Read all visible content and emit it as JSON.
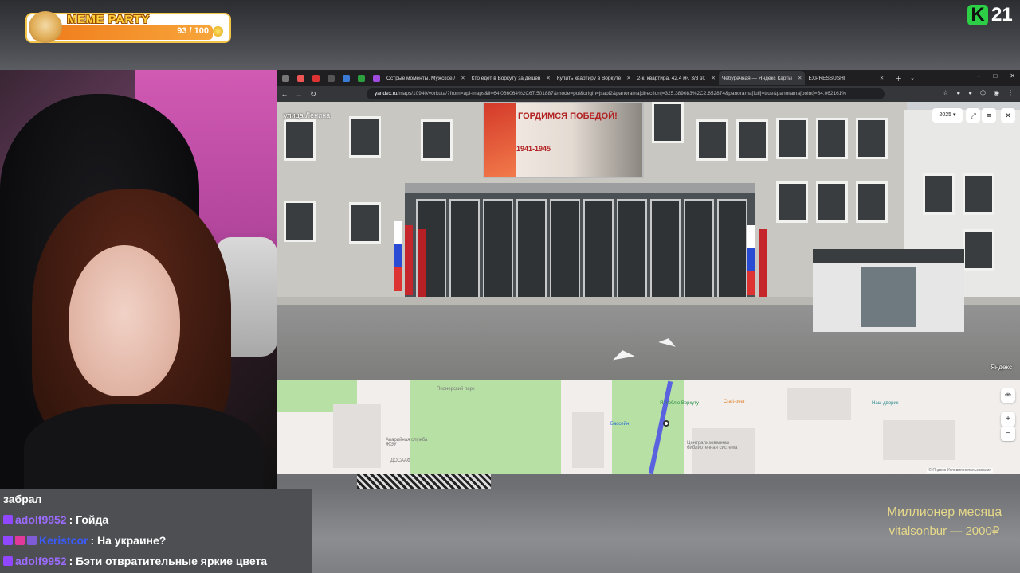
{
  "meme_widget": {
    "title": "MEME PARTY",
    "progress_text": "93 / 100",
    "progress": 0.93
  },
  "logo": {
    "k": "K",
    "num": "21"
  },
  "browser": {
    "tabs": [
      {
        "label": "Острые моменты. Мужское /",
        "active": false
      },
      {
        "label": "Кто едет в Воркуту за дешев",
        "active": false
      },
      {
        "label": "Купить квартиру в Воркуте",
        "active": false
      },
      {
        "label": "2-к. квартира, 42,4 м², 3/3 эт.",
        "active": false
      },
      {
        "label": "Чебуречная — Яндекс Карты",
        "active": true
      },
      {
        "label": "EXPRESSUSHI",
        "active": false
      }
    ],
    "url_host": "yandex.ru",
    "url_rest": "/maps/10940/vorkuta/?from=api-maps&ll=64.066064%2C67.501887&mode=poi&origin=jsapi2&panorama[direction]=325.389083%2C2.852874&panorama[full]=true&panorama[point]=64.062161%"
  },
  "panorama": {
    "street": "улица Ленина",
    "year": "2025",
    "banner_title": "ГОРДИМСЯ ПОБЕДОЙ!",
    "banner_years": "1941-1945",
    "brand": "Яндекс"
  },
  "map": {
    "labels": [
      {
        "text": "Пионерский парк"
      },
      {
        "text": "Я люблю Воркуту"
      },
      {
        "text": "Craft-bear"
      },
      {
        "text": "Бассейн"
      },
      {
        "text": "Наш дворик"
      },
      {
        "text": "Централизованная библиотечная система"
      },
      {
        "text": "Аварийная служба ЖЭУ"
      },
      {
        "text": "ДОСААФ"
      }
    ],
    "footer": "© Яндекс  Условия использования"
  },
  "chat": {
    "first_line": "забрал",
    "messages": [
      {
        "user": "adolf9952",
        "text": ": Гойда"
      },
      {
        "user": "Keristcor",
        "text": ": На украине?"
      },
      {
        "user": "adolf9952",
        "text": ": Бэти отвратительные яркие цвета"
      }
    ]
  },
  "million": {
    "title": "Миллионер месяца",
    "subtitle": "vitalsonbur — 2000₽"
  }
}
